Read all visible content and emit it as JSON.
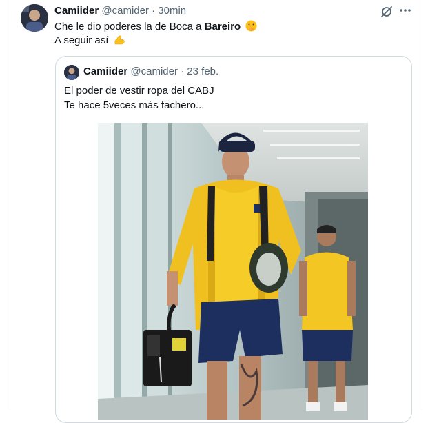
{
  "tweet": {
    "author_name": "Camiider",
    "author_handle": "@camider",
    "separator": "·",
    "time": "30min",
    "text_line1_start": "Che le dio poderes la de Boca a ",
    "text_line1_bold": "Bareiro",
    "text_line2": "A seguir así",
    "emoji_1": "shushing-face-emoji",
    "emoji_2": "flexed-biceps-emoji"
  },
  "quoted_tweet": {
    "author_name": "Camiider",
    "author_handle": "@camider",
    "separator": "·",
    "date": "23 feb.",
    "text_line1": "El poder de vestir ropa del CABJ",
    "text_line2": "Te hace 5veces más fachero..."
  },
  "icons": {
    "grok": "grok-icon",
    "more": "more-options-icon"
  },
  "colors": {
    "text_primary": "#0f1419",
    "text_secondary": "#536471",
    "border": "#cfd9de",
    "boca_yellow": "#f3c623",
    "boca_navy": "#1c2f5e"
  }
}
